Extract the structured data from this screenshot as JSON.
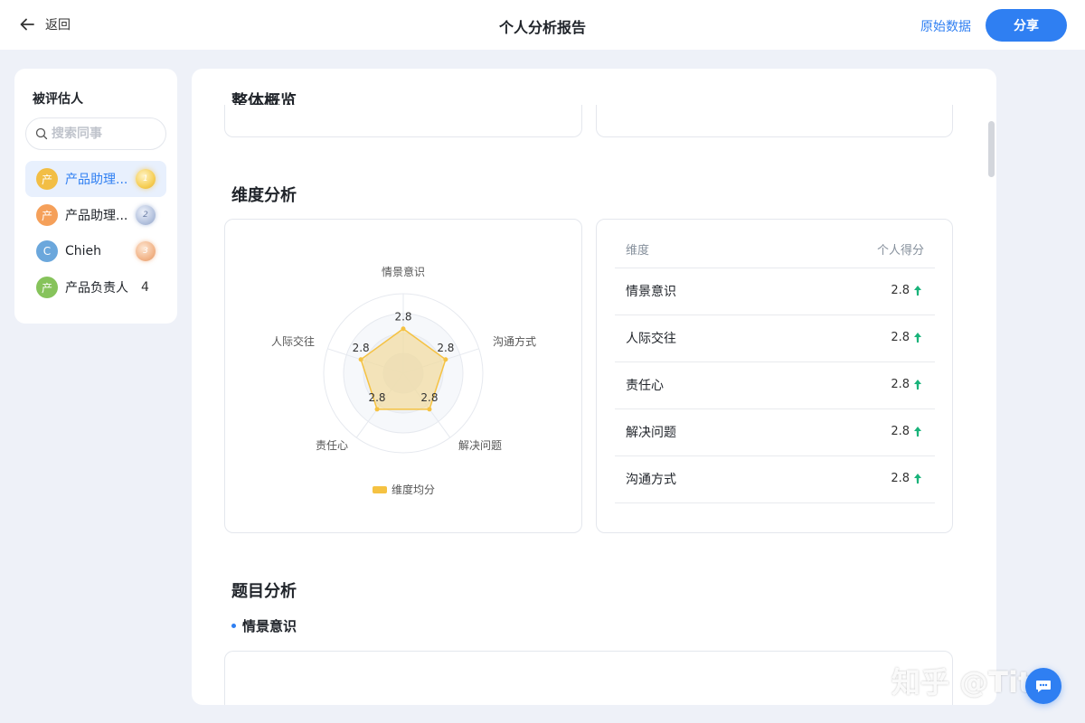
{
  "header": {
    "back_label": "返回",
    "title": "个人分析报告",
    "raw_data_label": "原始数据",
    "share_label": "分享"
  },
  "sidebar": {
    "title": "被评估人",
    "search_placeholder": "搜索同事",
    "people": [
      {
        "avatar": "产",
        "name": "产品助理...",
        "rank": "1",
        "avatar_color": "#f2be45",
        "active": true
      },
      {
        "avatar": "产",
        "name": "产品助理...",
        "rank": "2",
        "avatar_color": "#f5a05a",
        "active": false
      },
      {
        "avatar": "C",
        "name": "Chieh",
        "rank": "3",
        "avatar_color": "#6ba7dc",
        "active": false
      },
      {
        "avatar": "产",
        "name": "产品负责人",
        "rank": "4",
        "avatar_color": "#86c35b",
        "active": false
      }
    ]
  },
  "sections": {
    "overview": "整体概览",
    "dimension": "维度分析",
    "question": "题目分析",
    "question_sub": "情景意识"
  },
  "chart_data": {
    "type": "radar",
    "axes": [
      "情景意识",
      "沟通方式",
      "解决问题",
      "责任心",
      "人际交往"
    ],
    "series": [
      {
        "name": "维度均分",
        "values": [
          2.8,
          2.8,
          2.8,
          2.8,
          2.8
        ],
        "color": "#f5c242"
      }
    ],
    "value_labels": [
      "2.8",
      "2.8",
      "2.8",
      "2.8",
      "2.8"
    ],
    "max": 5,
    "legend": "bottom"
  },
  "table": {
    "headers": [
      "维度",
      "个人得分"
    ],
    "rows": [
      {
        "name": "情景意识",
        "score": "2.8"
      },
      {
        "name": "人际交往",
        "score": "2.8"
      },
      {
        "name": "责任心",
        "score": "2.8"
      },
      {
        "name": "解决问题",
        "score": "2.8"
      },
      {
        "name": "沟通方式",
        "score": "2.8"
      }
    ]
  },
  "watermark": "知乎 @Tita",
  "colors": {
    "accent": "#2f7ff2",
    "up_arrow": "#19b37a"
  }
}
